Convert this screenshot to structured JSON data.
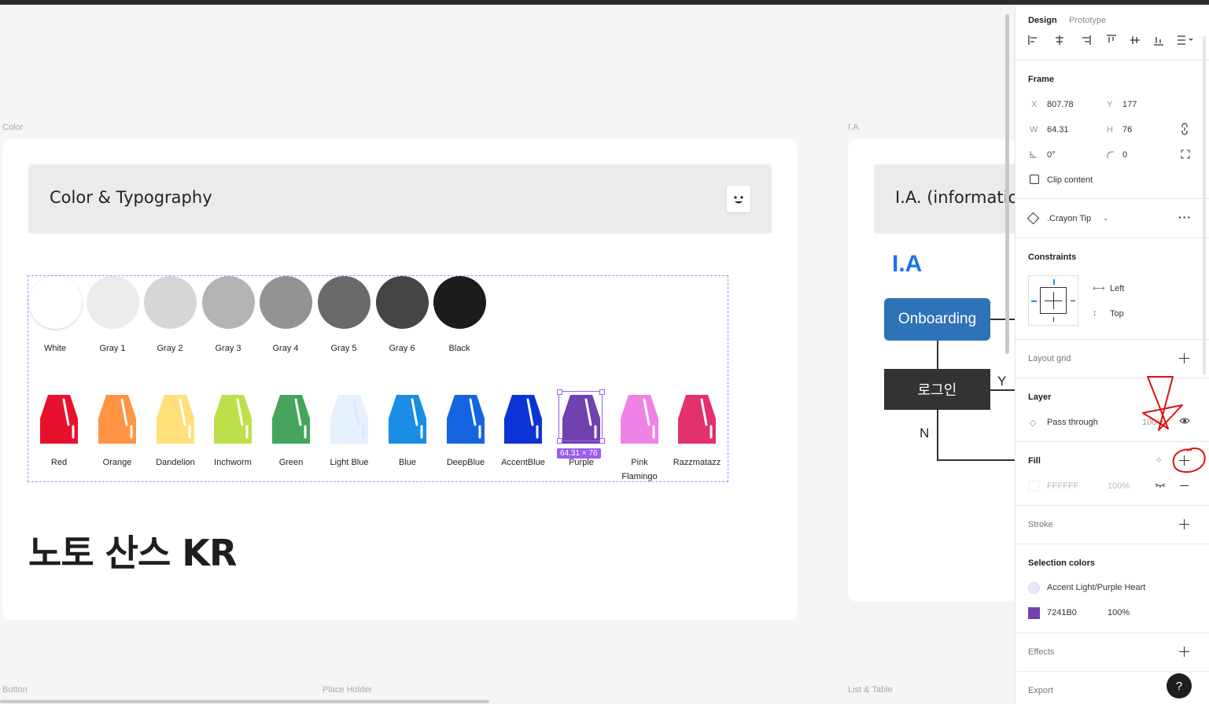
{
  "frames": {
    "color_label": "Color",
    "ia_label": "I.A.",
    "button_label": "Button",
    "placeholder_label": "Place Holder",
    "list_label": "List & Table"
  },
  "color_frame": {
    "title": "Color & Typography",
    "grays": [
      {
        "label": "White",
        "color": "#ffffff"
      },
      {
        "label": "Gray 1",
        "color": "#ebebeb"
      },
      {
        "label": "Gray 2",
        "color": "#d6d6d6"
      },
      {
        "label": "Gray 3",
        "color": "#b3b3b3"
      },
      {
        "label": "Gray 4",
        "color": "#939393"
      },
      {
        "label": "Gray 5",
        "color": "#6a6a6a"
      },
      {
        "label": "Gray 6",
        "color": "#454545"
      },
      {
        "label": "Black",
        "color": "#1c1c1c"
      }
    ],
    "crayons": [
      {
        "label": "Red",
        "color": "#e8112d"
      },
      {
        "label": "Orange",
        "color": "#ff9444"
      },
      {
        "label": "Dandelion",
        "color": "#ffe07a"
      },
      {
        "label": "Inchworm",
        "color": "#bde04a"
      },
      {
        "label": "Green",
        "color": "#46a45c"
      },
      {
        "label": "Light Blue",
        "color": "#e5f1fc"
      },
      {
        "label": "Blue",
        "color": "#1a8ee4"
      },
      {
        "label": "DeepBlue",
        "color": "#1565e0"
      },
      {
        "label": "AccentBlue",
        "color": "#0a35d4"
      },
      {
        "label": "Purple",
        "color": "#7241b0"
      },
      {
        "label": "Pink Flamingo",
        "color": "#ee82e6"
      },
      {
        "label": "Razzmatazz",
        "color": "#e3306e"
      }
    ],
    "selection_size": "64.31 × 76",
    "font_title": "노토 산스 KR"
  },
  "ia_frame": {
    "title": "I.A. (information",
    "heading": "I.A",
    "onboarding": "Onboarding",
    "login": "로그인",
    "yes": "Y",
    "no": "N"
  },
  "panel": {
    "tabs": [
      "Design",
      "Prototype"
    ],
    "frame": {
      "title": "Frame",
      "x_label": "X",
      "x": "807.78",
      "y_label": "Y",
      "y": "177",
      "w_label": "W",
      "w": "64.31",
      "h_label": "H",
      "h": "76",
      "rotation": "0°",
      "radius": "0",
      "clip": "Clip content"
    },
    "component": ".Crayon Tip",
    "constraints": {
      "title": "Constraints",
      "horizontal": "Left",
      "vertical": "Top"
    },
    "layout_grid": "Layout grid",
    "layer": {
      "title": "Layer",
      "mode": "Pass through",
      "opacity": "100%"
    },
    "fill": {
      "title": "Fill",
      "hex": "FFFFFF",
      "opacity": "100%"
    },
    "stroke": "Stroke",
    "selection_colors": {
      "title": "Selection colors",
      "items": [
        {
          "name": "Accent Light/Purple Heart",
          "color": "#ede6fb"
        },
        {
          "name": "7241B0",
          "opacity": "100%",
          "color": "#7241b0"
        }
      ]
    },
    "effects": "Effects",
    "export": "Export",
    "help": "?"
  }
}
